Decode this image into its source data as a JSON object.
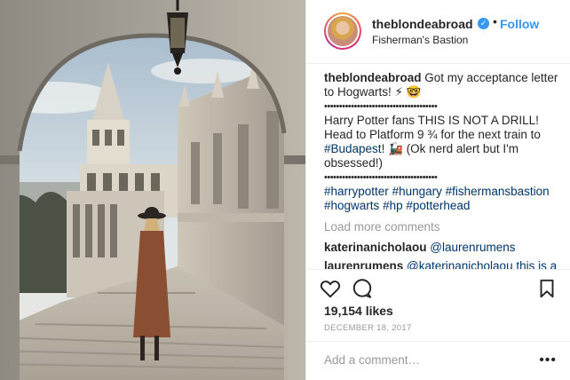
{
  "post": {
    "username": "theblondeabroad",
    "verified_glyph": "✓",
    "separator": "•",
    "follow_label": "Follow",
    "location": "Fisherman's Bastion"
  },
  "caption": {
    "username": "theblondeabroad",
    "line1": "Got my acceptance letter to Hogwarts! ⚡ 🤓",
    "dots1": "••••••••••••••••••••••••••••••••••••••",
    "line2a": "Harry Potter fans THIS IS NOT A DRILL! Head to Platform 9 ¾ for the next train to ",
    "hashtag_budapest": "#Budapest",
    "line2b": "! 🚂 (Ok nerd alert but I'm obsessed!)",
    "dots2": "••••••••••••••••••••••••••••••••••••••",
    "hashtags": [
      "#harrypotter",
      "#hungary",
      "#fishermansbastion",
      "#hogwarts",
      "#hp",
      "#potterhead"
    ]
  },
  "comments": {
    "load_more": "Load more comments",
    "items": [
      {
        "user": "katerinanicholaou",
        "text": "@laurenrumens"
      },
      {
        "user": "laurenrumens",
        "text": "@katerinanicholaou this is a"
      }
    ]
  },
  "actions": {
    "icons": [
      "heart-icon",
      "comment-icon",
      "bookmark-icon"
    ]
  },
  "likes": "19,154 likes",
  "date": "DECEMBER 18, 2017",
  "add_comment": {
    "placeholder": "Add a comment…",
    "more": "•••"
  }
}
